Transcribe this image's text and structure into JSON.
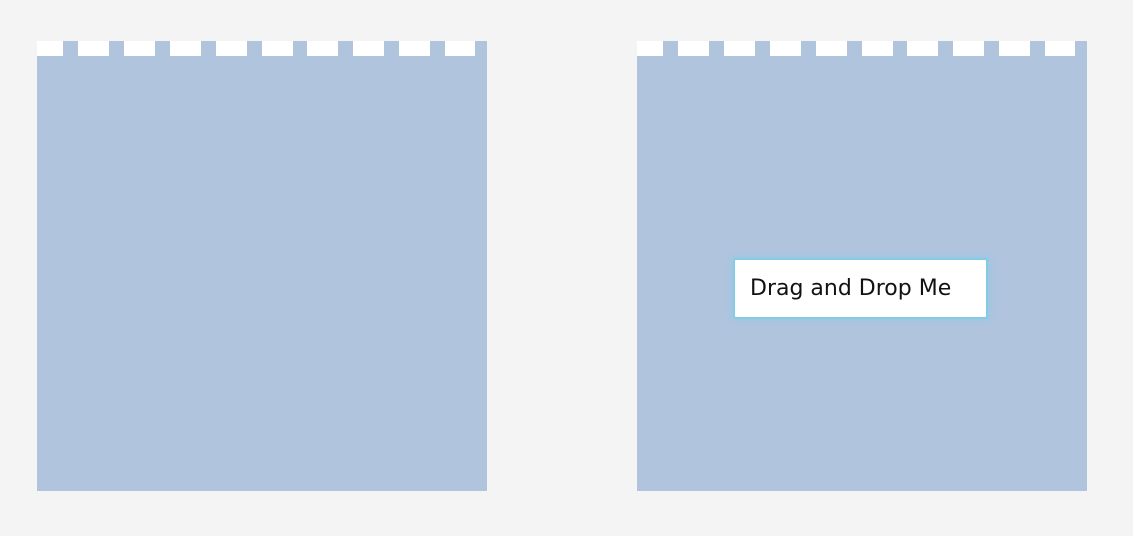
{
  "colors": {
    "page_background": "#f4f4f4",
    "zone_background": "#b0c4de",
    "notch_color": "#ffffff",
    "card_border": "#87cbe3",
    "card_text": "#111111"
  },
  "drop_zones": [
    {
      "name": "drop-zone-left"
    },
    {
      "name": "drop-zone-right"
    }
  ],
  "draggable": {
    "label": "Drag and Drop Me"
  }
}
